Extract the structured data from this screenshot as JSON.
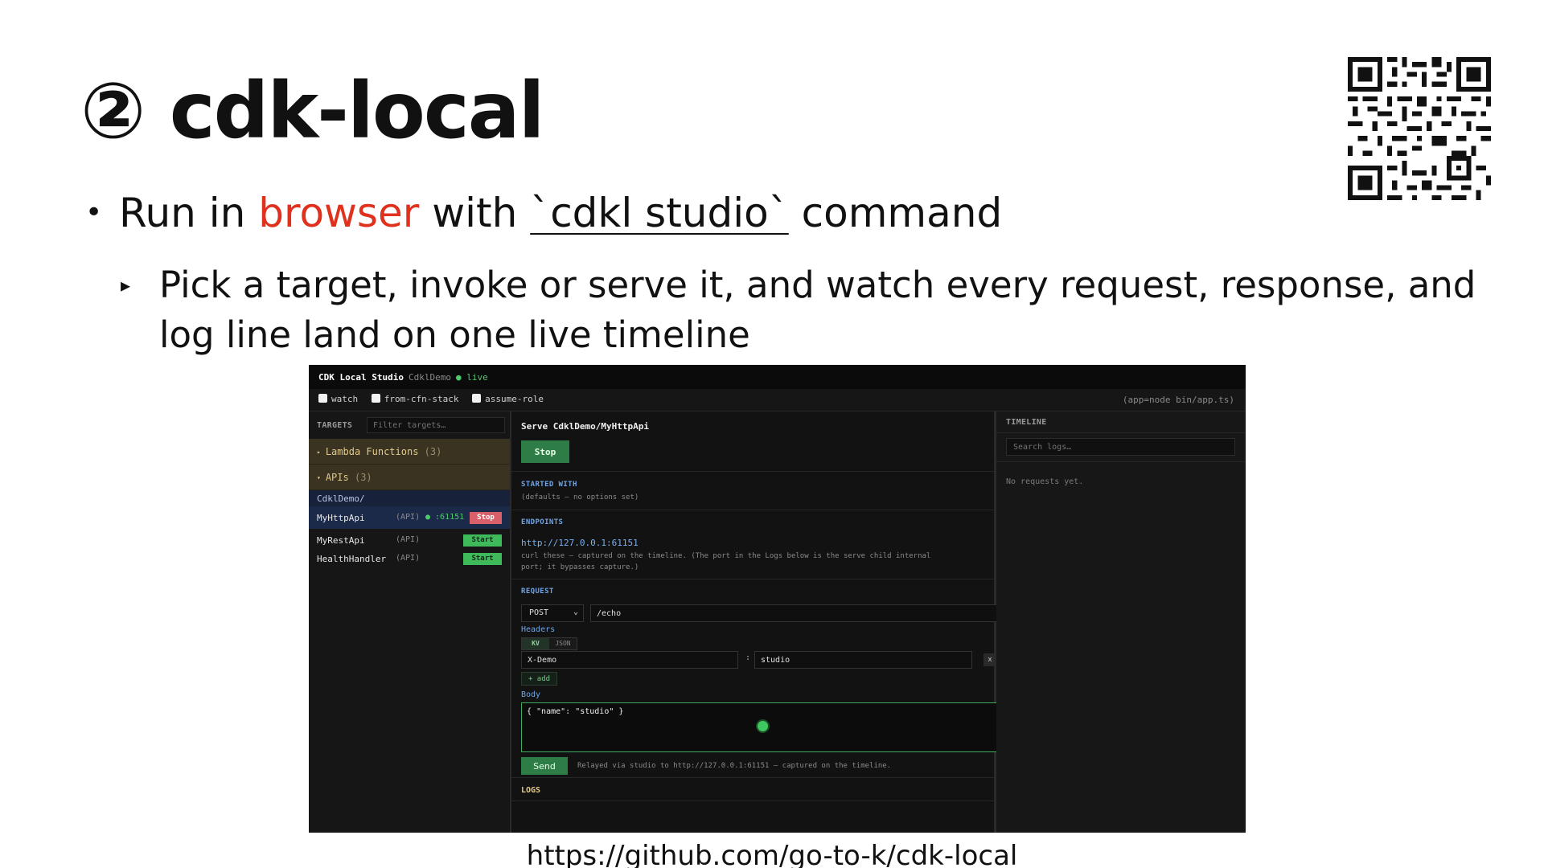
{
  "slide": {
    "title": "② cdk-local",
    "bullet1": {
      "marker": "•",
      "prefix": "Run in ",
      "highlight": "browser",
      "middle": " with ",
      "command": "`cdkl studio`",
      "suffix": " command"
    },
    "bullet2": {
      "marker": "▸",
      "text": "Pick a target, invoke or serve it, and watch every request, response, and log line land on one live timeline"
    },
    "link": "https://github.com/go-to-k/cdk-local",
    "colors": {
      "accent": "#e0301e",
      "text": "#111111"
    }
  },
  "qr": {
    "icon": "qr-code-icon"
  },
  "studio": {
    "header": {
      "app": "CDK Local Studio",
      "project": "CdklDemo",
      "status": "● live"
    },
    "toolbar": {
      "options": [
        "watch",
        "from-cfn-stack",
        "assume-role"
      ],
      "app_command": "(app=node bin/app.ts)"
    },
    "targets": {
      "label": "TARGETS",
      "filter_placeholder": "Filter targets…",
      "groups": [
        {
          "caret": "▸",
          "name": "Lambda Functions",
          "count": "(3)"
        },
        {
          "caret": "▾",
          "name": "APIs",
          "count": "(3)"
        }
      ],
      "breadcrumb": "CdklDemo/",
      "items": [
        {
          "name": "MyHttpApi",
          "kind": "(API)",
          "port": "● :61151",
          "action": "Stop"
        },
        {
          "name": "MyRestApi",
          "kind": "(API)",
          "action": "Start"
        },
        {
          "name": "HealthHandler",
          "kind": "(API)",
          "action": "Start"
        }
      ]
    },
    "serve": {
      "title": "Serve CdklDemo/MyHttpApi",
      "stop_label": "Stop",
      "started_with_label": "STARTED WITH",
      "started_with_value": "(defaults — no options set)",
      "endpoints_label": "ENDPOINTS",
      "endpoint_url": "http://127.0.0.1:61151",
      "endpoint_note_1": "curl these — captured on the timeline. (The port in the Logs below is the serve child internal",
      "endpoint_note_2": "port; it bypasses capture.)",
      "request_label": "REQUEST",
      "method": "POST",
      "path": "/echo",
      "headers_label": "Headers",
      "header_modes": [
        "KV",
        "JSON"
      ],
      "header_key": "X-Demo",
      "header_sep": ":",
      "header_value": "studio",
      "remove_label": "x",
      "add_label": "+ add",
      "body_label": "Body",
      "body_value": "{ \"name\": \"studio\" }",
      "send_label": "Send",
      "relay_note": "Relayed via studio to http://127.0.0.1:61151 — captured on the timeline.",
      "logs_label": "LOGS"
    },
    "timeline": {
      "label": "TIMELINE",
      "search_placeholder": "Search logs…",
      "empty": "No requests yet."
    },
    "colors": {
      "bg": "#121212",
      "green": "#2e7d46",
      "live": "#4ec96c",
      "link": "#7ab0f2",
      "group": "#3a3322",
      "stop": "#d8606a"
    }
  }
}
